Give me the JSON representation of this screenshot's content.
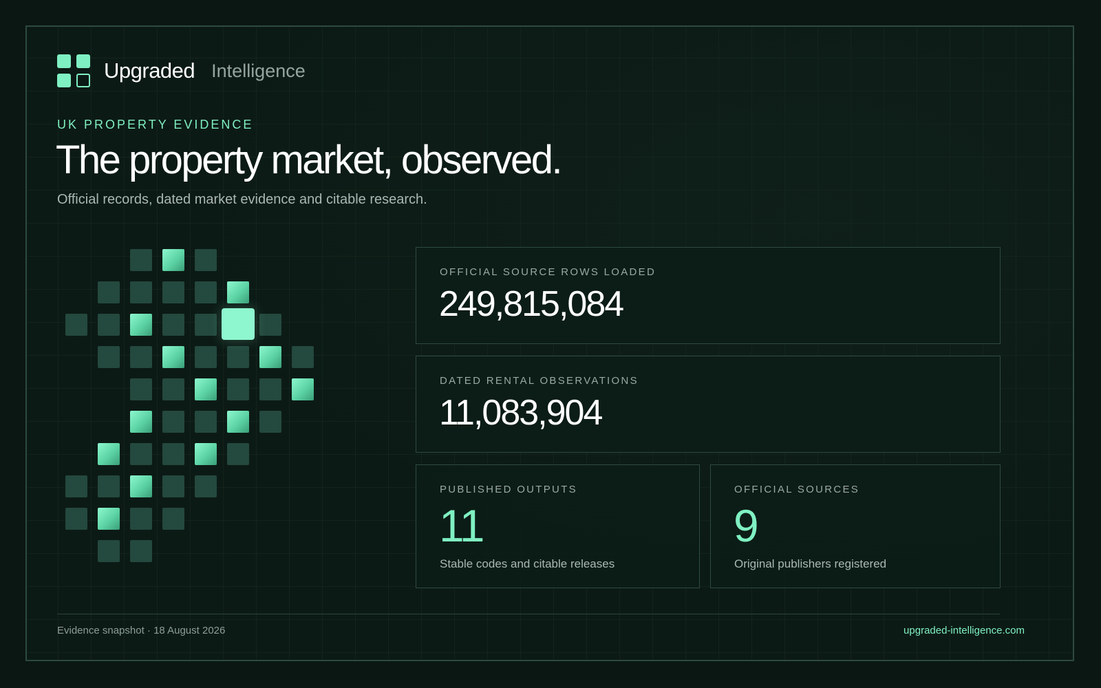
{
  "brand": {
    "name": "Upgraded",
    "subtitle": "Intelligence",
    "logo_icon": "four-squares-logo-icon",
    "accent_color": "#7ff0c2"
  },
  "hero": {
    "eyebrow": "UK PROPERTY EVIDENCE",
    "headline": "The property market, observed.",
    "lede": "Official records, dated market evidence and citable research."
  },
  "stats": {
    "source_rows": {
      "label": "OFFICIAL SOURCE ROWS LOADED",
      "value": "249,815,084"
    },
    "rental_observations": {
      "label": "DATED RENTAL OBSERVATIONS",
      "value": "11,083,904"
    },
    "published_outputs": {
      "label": "PUBLISHED OUTPUTS",
      "value": "11",
      "note": "Stable codes and citable releases"
    },
    "official_sources": {
      "label": "OFFICIAL SOURCES",
      "value": "9",
      "note": "Original publishers registered"
    }
  },
  "footer": {
    "snapshot": "Evidence snapshot · 18 August 2026",
    "site": "upgraded-intelligence.com"
  },
  "colors": {
    "background": "#0b1713",
    "panel_border": "#2e4b41",
    "tile_dim": "#24493e",
    "tile_bright": "#8ef7cf"
  }
}
